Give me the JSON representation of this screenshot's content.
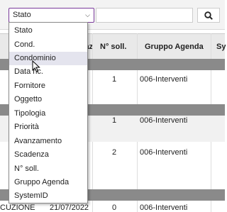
{
  "filter": {
    "selected": "Stato",
    "search_value": "",
    "options": [
      "Stato",
      "Cond.",
      "Condominio",
      "Data ric.",
      "Fornitore",
      "Oggetto",
      "Tipologia",
      "Priorità",
      "Avanzamento",
      "Scadenza",
      "N° soll.",
      "Gruppo Agenda",
      "SystemID"
    ],
    "highlighted": "Condominio"
  },
  "table": {
    "headers": {
      "col0": "zaz",
      "num": "N° soll.",
      "gruppo": "Gruppo Agenda",
      "next": "Sy"
    },
    "rows": [
      {
        "num": "1",
        "gruppo": "006-Interventi"
      },
      {
        "num": "1",
        "gruppo": "006-Interventi"
      },
      {
        "num": "2",
        "gruppo": "006-Interventi"
      },
      {
        "col0": "CUZIONE",
        "date": "21/07/2022",
        "num": "0",
        "gruppo": "006-Interventi"
      }
    ]
  },
  "colors": {
    "accent_border": "#7a3a9a",
    "group_row": "#8a8a8a"
  }
}
